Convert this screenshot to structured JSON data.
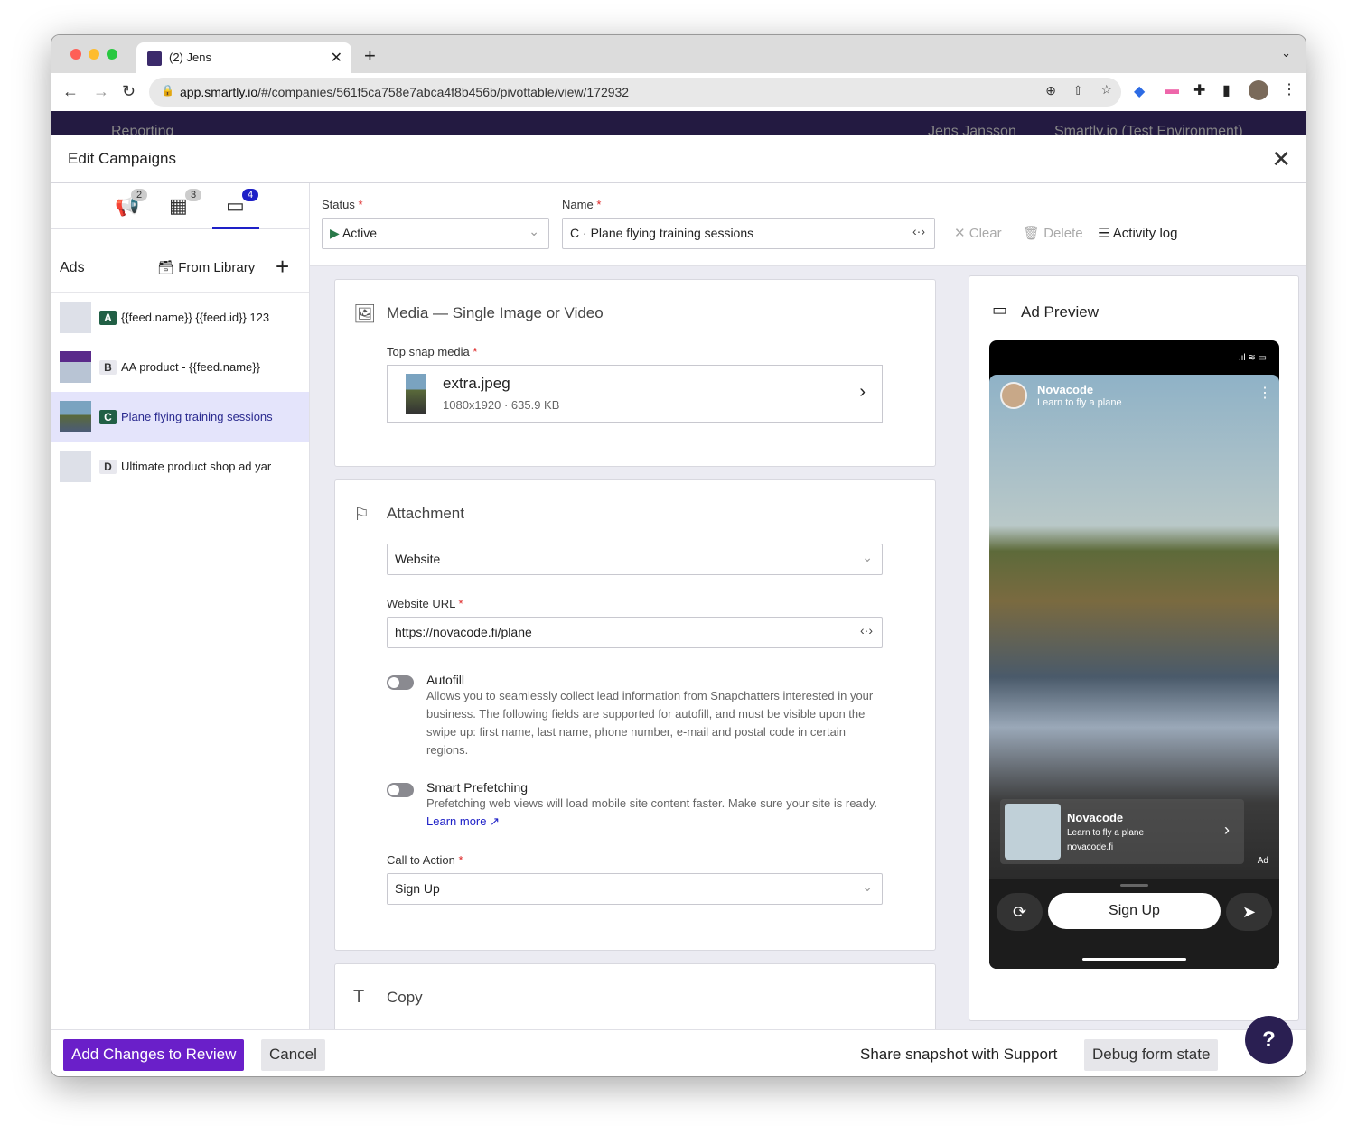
{
  "browser": {
    "tab_title": "(2) Jens",
    "url_host": "app.smartly.io",
    "url_path": "/#/companies/561f5ca758e7abca4f8b456b/pivottable/view/172932"
  },
  "app_nav": {
    "reporting": "Reporting",
    "notifications": "2",
    "user": "Jens Jansson",
    "account": "Smartly.io (Test Environment)"
  },
  "modal": {
    "title": "Edit Campaigns"
  },
  "level_tabs": [
    {
      "icon": "megaphone-icon",
      "count": "2"
    },
    {
      "icon": "grid-icon",
      "count": "3"
    },
    {
      "icon": "tablet-icon",
      "count": "4",
      "active": true
    }
  ],
  "ads": {
    "heading": "Ads",
    "from_library": "From Library",
    "items": [
      {
        "letter": "A",
        "name": "{{feed.name}} {{feed.id}} 123",
        "active": true
      },
      {
        "letter": "B",
        "name": "AA product - {{feed.name}}",
        "active": false
      },
      {
        "letter": "C",
        "name": "Plane flying training sessions",
        "active": true,
        "selected": true
      },
      {
        "letter": "D",
        "name": "Ultimate product shop ad yar",
        "active": false
      }
    ]
  },
  "top_fields": {
    "status_label": "Status",
    "status_value": "Active",
    "name_label": "Name",
    "name_prefix": "C",
    "name_value": "Plane flying training sessions",
    "clear": "Clear",
    "delete": "Delete",
    "activity_log": "Activity log"
  },
  "media": {
    "title": "Media — Single Image or Video",
    "top_snap_label": "Top snap media",
    "file_name": "extra.jpeg",
    "file_meta": "1080x1920 · 635.9 KB"
  },
  "attachment": {
    "title": "Attachment",
    "type": "Website",
    "url_label": "Website URL",
    "url_value": "https://novacode.fi/plane",
    "autofill_title": "Autofill",
    "autofill_desc": "Allows you to seamlessly collect lead information from Snapchatters interested in your business. The following fields are supported for autofill, and must be visible upon the swipe up: first name, last name, phone number, e-mail and postal code in certain regions.",
    "autofill_on": false,
    "prefetch_title": "Smart Prefetching",
    "prefetch_desc": "Prefetching web views will load mobile site content faster. Make sure your site is ready.",
    "learn_more": "Learn more",
    "prefetch_on": false,
    "cta_label": "Call to Action",
    "cta_value": "Sign Up"
  },
  "copy": {
    "title": "Copy"
  },
  "preview": {
    "title": "Ad Preview",
    "brand": "Novacode",
    "headline": "Learn to fly a plane",
    "domain": "novacode.fi",
    "ad_tag": "Ad",
    "cta": "Sign Up"
  },
  "footer": {
    "add_review": "Add Changes to Review",
    "cancel": "Cancel",
    "share": "Share snapshot with Support",
    "debug": "Debug form state"
  },
  "colors": {
    "primary": "#6a1fc9",
    "accent": "#1e20c7",
    "nav": "#231a41",
    "active_green": "#215f45"
  }
}
